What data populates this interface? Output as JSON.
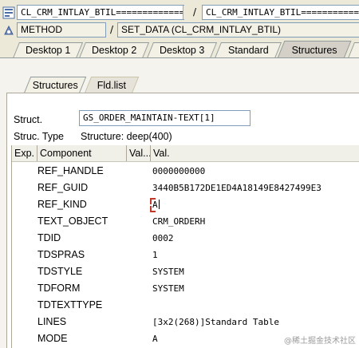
{
  "top_row1": {
    "left_value": "CL_CRM_INTLAY_BTIL=============",
    "separator": "/",
    "right_value": "CL_CRM_INTLAY_BTIL=============="
  },
  "top_row2": {
    "left_value": "METHOD",
    "separator": "/",
    "right_value": "SET_DATA (CL_CRM_INTLAY_BTIL)"
  },
  "main_tabs": [
    {
      "label": "Desktop 1",
      "active": false
    },
    {
      "label": "Desktop 2",
      "active": false
    },
    {
      "label": "Desktop 3",
      "active": false
    },
    {
      "label": "Standard",
      "active": false
    },
    {
      "label": "Structures",
      "active": true
    }
  ],
  "sub_tabs": [
    {
      "label": "Structures",
      "active": false
    },
    {
      "label": "Fld.list",
      "active": true
    }
  ],
  "struct": {
    "label": "Struct.",
    "value": "GS_ORDER_MAINTAIN-TEXT[1]",
    "type_label": "Struc. Type",
    "type_value": "Structure: deep(400)"
  },
  "grid": {
    "headers": [
      "Exp.",
      "Component",
      "Val...",
      "Val."
    ],
    "rows": [
      {
        "component": "REF_HANDLE",
        "value": "0000000000"
      },
      {
        "component": "REF_GUID",
        "value": "3440B5B172DE1ED4A18149E8427499E3"
      },
      {
        "component": "REF_KIND",
        "value": "A"
      },
      {
        "component": "TEXT_OBJECT",
        "value": "CRM_ORDERH"
      },
      {
        "component": "TDID",
        "value": "0002"
      },
      {
        "component": "TDSPRAS",
        "value": "1"
      },
      {
        "component": "TDSTYLE",
        "value": "SYSTEM"
      },
      {
        "component": "TDFORM",
        "value": "SYSTEM"
      },
      {
        "component": "TDTEXTTYPE",
        "value": ""
      },
      {
        "component": "LINES",
        "value": "[3x2(268)]Standard Table"
      },
      {
        "component": "MODE",
        "value": "A"
      }
    ]
  },
  "watermark": "@稀土掘金技术社区",
  "colors": {
    "active_tab": "#d4d0c8",
    "caret": "#c0392b",
    "field_border": "#7f9db9"
  }
}
